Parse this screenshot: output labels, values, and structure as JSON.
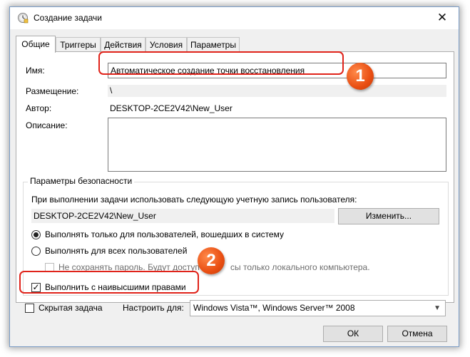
{
  "window": {
    "title": "Создание задачи",
    "close_glyph": "✕"
  },
  "tabs": [
    {
      "label": "Общие"
    },
    {
      "label": "Триггеры"
    },
    {
      "label": "Действия"
    },
    {
      "label": "Условия"
    },
    {
      "label": "Параметры"
    }
  ],
  "general": {
    "name_label": "Имя:",
    "name_value": "Автоматическое создание точки восстановления",
    "location_label": "Размещение:",
    "location_value": "\\",
    "author_label": "Автор:",
    "author_value": "DESKTOP-2CE2V42\\New_User",
    "description_label": "Описание:",
    "description_value": ""
  },
  "security": {
    "group_title": "Параметры безопасности",
    "account_prompt": "При выполнении задачи использовать следующую учетную запись пользователя:",
    "account_value": "DESKTOP-2CE2V42\\New_User",
    "change_button": "Изменить...",
    "radio_logged_on": "Выполнять только для пользователей, вошедших в систему",
    "radio_all_users": "Выполнять для всех пользователей",
    "no_save_password": "Не сохранять пароль. Будут доступ",
    "no_save_password_tail": "сы только локального компьютера.",
    "highest_privileges": "Выполнить с наивысшими правами"
  },
  "footer": {
    "hidden_task": "Скрытая задача",
    "configure_label": "Настроить для:",
    "configure_value": "Windows Vista™, Windows Server™ 2008",
    "ok": "ОК",
    "cancel": "Отмена"
  },
  "annotations": {
    "marker1": "1",
    "marker2": "2",
    "color": "#e0231a"
  },
  "state": {
    "active_tab": "Общие",
    "selected_radio": "logged_on",
    "highest_privileges_checked": true,
    "hidden_task_checked": false
  }
}
